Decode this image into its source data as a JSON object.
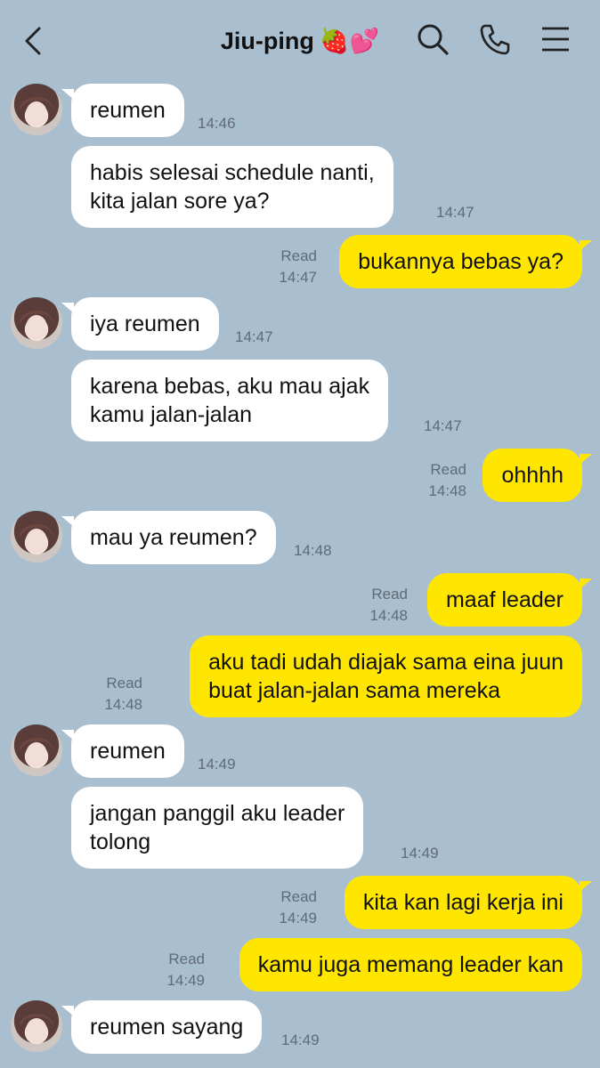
{
  "header": {
    "title": "Jiu-ping",
    "title_emoji": "🍓💕",
    "back_icon": "chevron-left-icon",
    "search_icon": "search-icon",
    "call_icon": "phone-icon",
    "menu_icon": "menu-icon"
  },
  "colors": {
    "background": "#a9bfd0",
    "incoming_bubble": "#ffffff",
    "outgoing_bubble": "#ffe600",
    "meta_text": "#5f6b76"
  },
  "messages": [
    {
      "from": "Jiu-ping",
      "text": "reumen",
      "time": "14:46"
    },
    {
      "from": "Jiu-ping",
      "lines": [
        "habis selesai schedule nanti,",
        "kita jalan sore ya?"
      ],
      "time": "14:47"
    },
    {
      "from": "me",
      "text": "bukannya bebas ya?",
      "read": "Read",
      "time": "14:47"
    },
    {
      "from": "Jiu-ping",
      "text": "iya reumen",
      "time": "14:47"
    },
    {
      "from": "Jiu-ping",
      "lines": [
        "karena bebas, aku mau ajak",
        "kamu jalan-jalan"
      ],
      "time": "14:47"
    },
    {
      "from": "me",
      "text": "ohhhh",
      "read": "Read",
      "time": "14:48"
    },
    {
      "from": "Jiu-ping",
      "text": "mau ya reumen?",
      "time": "14:48"
    },
    {
      "from": "me",
      "text": "maaf leader",
      "read": "Read",
      "time": "14:48"
    },
    {
      "from": "me",
      "lines": [
        "aku tadi udah diajak sama eina juun",
        "buat jalan-jalan sama mereka"
      ],
      "read": "Read",
      "time": "14:48"
    },
    {
      "from": "Jiu-ping",
      "text": "reumen",
      "time": "14:49"
    },
    {
      "from": "Jiu-ping",
      "lines": [
        "jangan panggil aku leader",
        "tolong"
      ],
      "time": "14:49"
    },
    {
      "from": "me",
      "text": "kita kan lagi kerja ini",
      "read": "Read",
      "time": "14:49"
    },
    {
      "from": "me",
      "text": "kamu juga memang leader kan",
      "read": "Read",
      "time": "14:49"
    },
    {
      "from": "Jiu-ping",
      "text": "reumen sayang",
      "time": "14:49"
    }
  ]
}
